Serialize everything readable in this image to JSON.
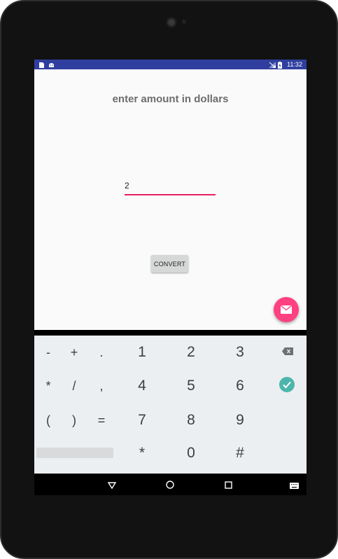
{
  "status_bar": {
    "time": "11:32",
    "icons": [
      "sd-card-icon",
      "android-icon",
      "signal-icon",
      "battery-icon"
    ]
  },
  "app": {
    "title": "enter amount in dollars",
    "amount_value": "2",
    "convert_label": "CONVERT",
    "fab_icon": "email-icon"
  },
  "keyboard": {
    "rows": [
      [
        "-",
        "+",
        ".",
        "1",
        "2",
        "3",
        "backspace"
      ],
      [
        "*",
        "/",
        ",",
        "4",
        "5",
        "6",
        "done"
      ],
      [
        "(",
        ")",
        "=",
        "7",
        "8",
        "9",
        ""
      ],
      [
        "space",
        "*",
        "0",
        "#"
      ]
    ]
  },
  "nav_bar": {
    "buttons": [
      "back",
      "home",
      "recents",
      "keyboard-switch"
    ]
  },
  "colors": {
    "status_bar": "#303f9f",
    "accent": "#e91e63",
    "fab": "#ff4081",
    "done_key": "#4db6ac"
  }
}
